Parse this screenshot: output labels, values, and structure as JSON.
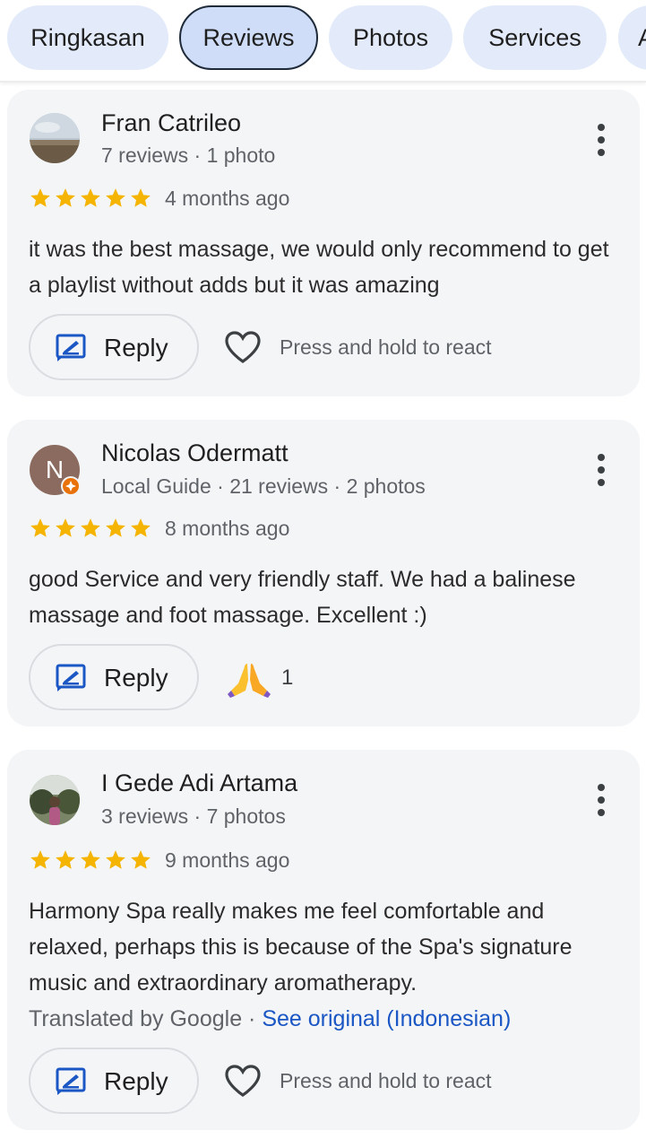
{
  "tabs": [
    {
      "label": "Ringkasan",
      "active": false
    },
    {
      "label": "Reviews",
      "active": true
    },
    {
      "label": "Photos",
      "active": false
    },
    {
      "label": "Services",
      "active": false
    },
    {
      "label": "A",
      "active": false
    }
  ],
  "reviews": [
    {
      "name": "Fran Catrileo",
      "meta": "7 reviews · 1 photo",
      "rating": 5,
      "ago": "4 months ago",
      "text": "it was the best massage, we would only recommend to get a playlist without adds but it was amazing",
      "reply_label": "Reply",
      "react_label": "Press and hold to react",
      "avatar_icon": "photo-avatar"
    },
    {
      "name": "Nicolas Odermatt",
      "meta": "Local Guide · 21 reviews · 2 photos",
      "rating": 5,
      "ago": "8 months ago",
      "text": "good Service and very friendly staff. We had a balinese massage and foot massage. Excellent :)",
      "reply_label": "Reply",
      "avatar_letter": "N",
      "reaction_count": "1",
      "reaction_icon": "folded-hands-emoji"
    },
    {
      "name": "I Gede Adi Artama",
      "meta": "3 reviews · 7 photos",
      "rating": 5,
      "ago": "9 months ago",
      "text": "Harmony Spa really makes me feel comfortable and relaxed, perhaps this is because of the Spa's signature music and extraordinary aromatherapy.",
      "translated_prefix": "Translated by Google · ",
      "see_original": "See original (Indonesian)",
      "reply_label": "Reply",
      "react_label": "Press and hold to react",
      "avatar_icon": "photo-avatar"
    }
  ],
  "colors": {
    "star": "#f4b400",
    "link": "#1a56c4",
    "reply_icon": "#1a56c4",
    "card_bg": "#f4f5f7",
    "tab_bg": "#e3ebfa"
  }
}
